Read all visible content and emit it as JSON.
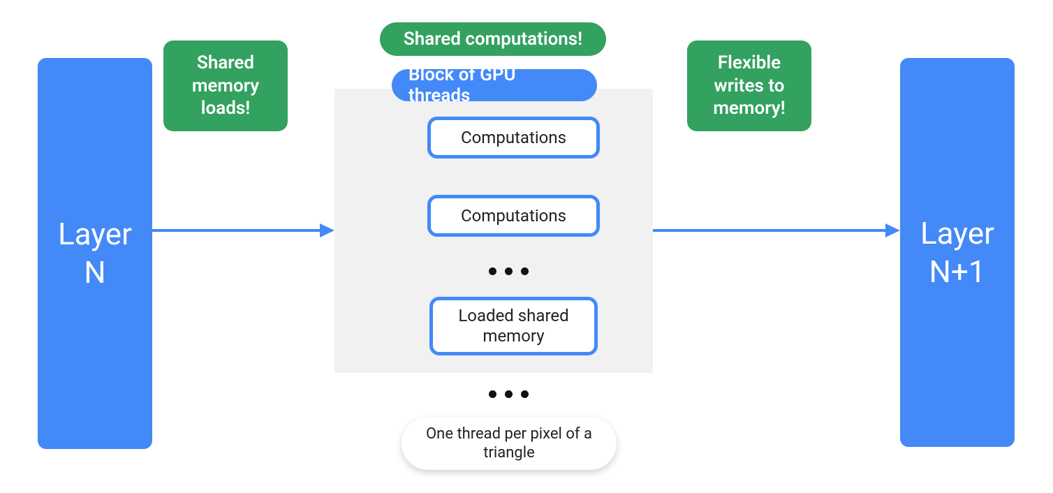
{
  "colors": {
    "blue": "#4389f8",
    "green": "#33a160",
    "gray": "#f1f1f1",
    "text": "#202124"
  },
  "layers": {
    "left": "Layer\nN",
    "right": "Layer\nN+1"
  },
  "callouts": {
    "shared_memory_loads": "Shared memory loads!",
    "shared_computations": "Shared computations!",
    "flexible_writes": "Flexible writes to memory!"
  },
  "block": {
    "title": "Block of GPU threads",
    "items": {
      "comp1": "Computations",
      "comp2": "Computations",
      "loaded": "Loaded shared memory"
    }
  },
  "footer": "One thread per pixel of a triangle"
}
